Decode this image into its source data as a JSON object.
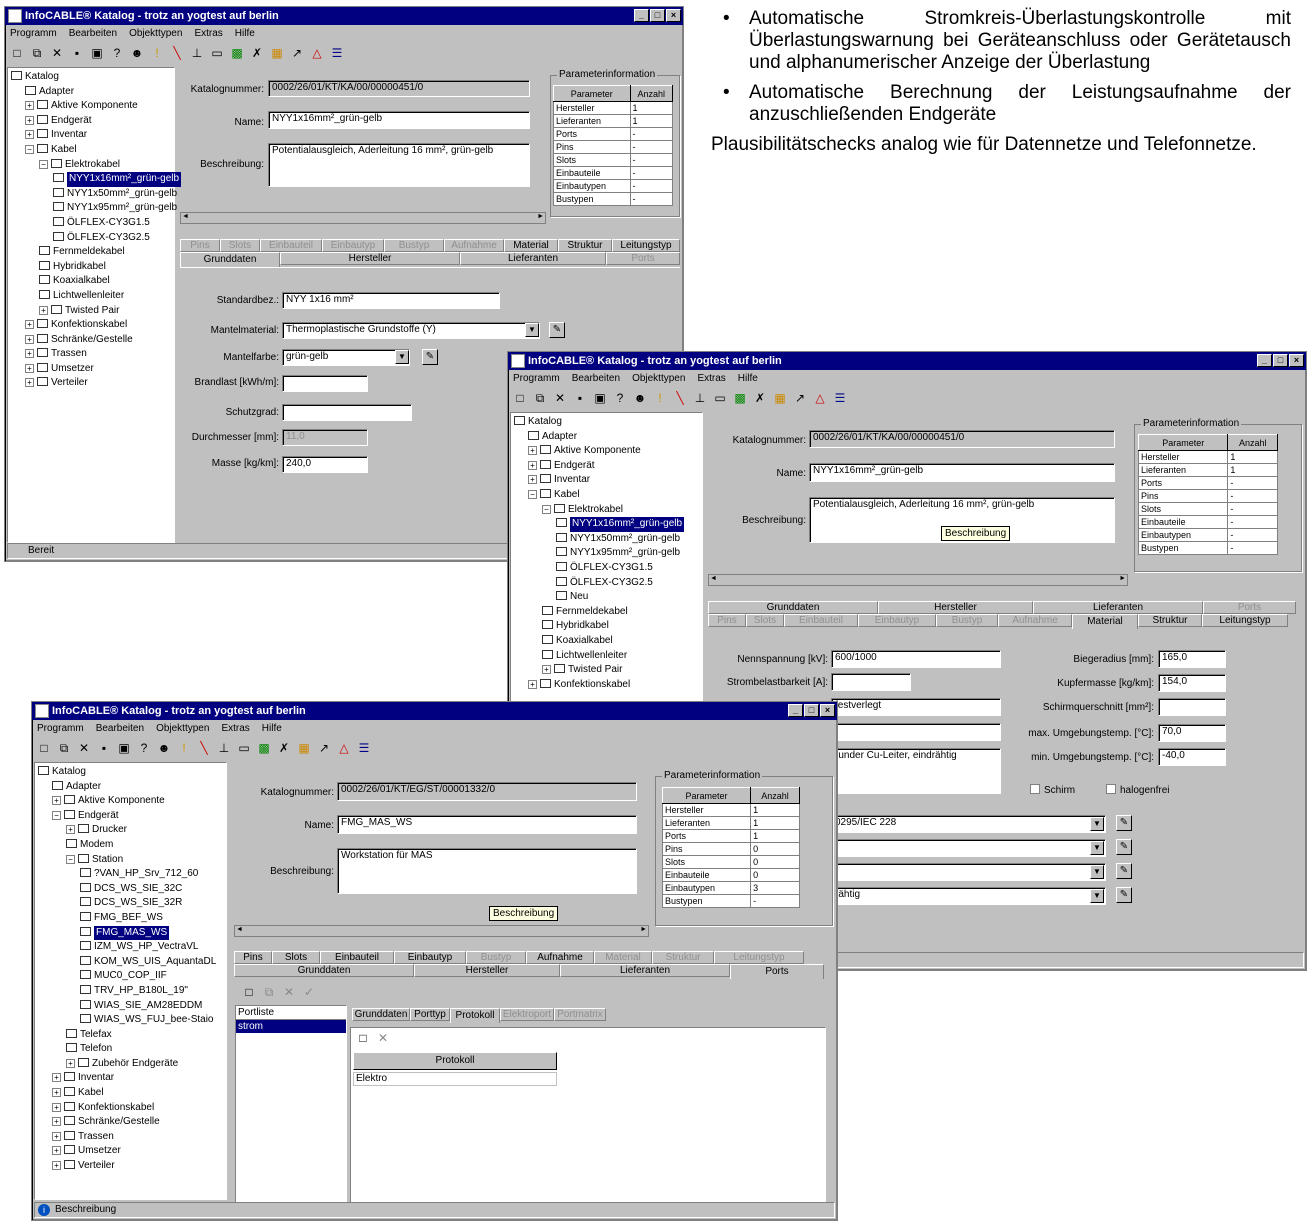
{
  "prose": {
    "bullet1": "Automatische Stromkreis-Überlastungs­kontrolle mit Überlastungswarnung bei Geräteanschluss oder Gerätetausch und alphanumerischer Anzeige der Überlastung",
    "bullet2": "Automatische Berechnung der Leistungsaufnahme der anzuschließenden Endgeräte",
    "paragraph": "Plausibilitätschecks analog wie für Datennetze und Telefonnetze."
  },
  "app": {
    "title": "InfoCABLE® Katalog - trotz an yogtest auf berlin",
    "menu": [
      "Programm",
      "Bearbeiten",
      "Objekttypen",
      "Extras",
      "Hilfe"
    ],
    "window_buttons": [
      "_",
      "□",
      "×"
    ]
  },
  "labels": {
    "katalognummer": "Katalognummer:",
    "name": "Name:",
    "beschreibung": "Beschreibung:",
    "parameterinformation": "Parameterinformation",
    "parameter": "Parameter",
    "anzahl": "Anzahl",
    "standardbez": "Standardbez.:",
    "mantelmaterial": "Mantelmaterial:",
    "mantelfarbe": "Mantelfarbe:",
    "brandlast": "Brandlast [kWh/m]:",
    "schutzgrad": "Schutzgrad:",
    "durchmesser": "Durchmesser [mm]:",
    "masse": "Masse [kg/km]:",
    "nennspannung": "Nennspannung [kV]:",
    "strombelastbarkeit": "Strombelastbarkeit [A]:",
    "biegeradius": "Biegeradius [mm]:",
    "kupfermasse": "Kupfermasse [kg/km]:",
    "schirmquerschnitt": "Schirmquerschnitt [mm²]:",
    "max_temp": "max. Umgebungstemp. [°C]:",
    "min_temp": "min. Umgebungstemp. [°C]:",
    "schirm": "Schirm",
    "halogenfrei": "halogenfrei",
    "portliste": "Portliste",
    "protokoll": "Protokoll"
  },
  "win1": {
    "tree": [
      {
        "t": "Katalog",
        "d": 0
      },
      {
        "t": "Adapter",
        "d": 1
      },
      {
        "t": "Aktive Komponente",
        "d": 1,
        "e": "+"
      },
      {
        "t": "Endgerät",
        "d": 1,
        "e": "+"
      },
      {
        "t": "Inventar",
        "d": 1,
        "e": "+"
      },
      {
        "t": "Kabel",
        "d": 1,
        "e": "-"
      },
      {
        "t": "Elektrokabel",
        "d": 2,
        "e": "-"
      },
      {
        "t": "NYY1x16mm²_grün-gelb",
        "d": 3,
        "sel": true
      },
      {
        "t": "NYY1x50mm²_grün-gelb",
        "d": 3
      },
      {
        "t": "NYY1x95mm²_grün-gelb",
        "d": 3
      },
      {
        "t": "ÖLFLEX-CY3G1.5",
        "d": 3
      },
      {
        "t": "ÖLFLEX-CY3G2.5",
        "d": 3
      },
      {
        "t": "Fernmeldekabel",
        "d": 2
      },
      {
        "t": "Hybridkabel",
        "d": 2
      },
      {
        "t": "Koaxialkabel",
        "d": 2
      },
      {
        "t": "Lichtwellenleiter",
        "d": 2
      },
      {
        "t": "Twisted Pair",
        "d": 2,
        "e": "+"
      },
      {
        "t": "Konfektionskabel",
        "d": 1,
        "e": "+"
      },
      {
        "t": "Schränke/Gestelle",
        "d": 1,
        "e": "+"
      },
      {
        "t": "Trassen",
        "d": 1,
        "e": "+"
      },
      {
        "t": "Umsetzer",
        "d": 1,
        "e": "+"
      },
      {
        "t": "Verteiler",
        "d": 1,
        "e": "+"
      }
    ],
    "katalognummer": "0002/26/01/KT/KA/00/00000451/0",
    "name": "NYY1x16mm²_grün-gelb",
    "beschreibung": "Potentialausgleich, Aderleitung 16 mm²,  grün-gelb",
    "params": [
      [
        "Hersteller",
        "1"
      ],
      [
        "Lieferanten",
        "1"
      ],
      [
        "Ports",
        "-"
      ],
      [
        "Pins",
        "-"
      ],
      [
        "Slots",
        "-"
      ],
      [
        "Einbauteile",
        "-"
      ],
      [
        "Einbautypen",
        "-"
      ],
      [
        "Bustypen",
        "-"
      ]
    ],
    "tabs_back": [
      "Pins",
      "Slots",
      "Einbauteil",
      "Einbautyp",
      "Bustyp",
      "Aufnahme",
      "Material",
      "Struktur",
      "Leitungstyp"
    ],
    "tabs_front": [
      "Grunddaten",
      "Hersteller",
      "Lieferanten",
      "Ports"
    ],
    "standardbez": "NYY 1x16 mm²",
    "mantelmaterial": "Thermoplastische Grundstoffe (Y)",
    "mantelfarbe": "grün-gelb",
    "brandlast": "",
    "schutzgrad": "",
    "durchmesser": "11,0",
    "masse": "240,0",
    "status": "Bereit"
  },
  "win2": {
    "tree": [
      {
        "t": "Katalog",
        "d": 0
      },
      {
        "t": "Adapter",
        "d": 1
      },
      {
        "t": "Aktive Komponente",
        "d": 1,
        "e": "+"
      },
      {
        "t": "Endgerät",
        "d": 1,
        "e": "+"
      },
      {
        "t": "Inventar",
        "d": 1,
        "e": "+"
      },
      {
        "t": "Kabel",
        "d": 1,
        "e": "-"
      },
      {
        "t": "Elektrokabel",
        "d": 2,
        "e": "-"
      },
      {
        "t": "NYY1x16mm²_grün-gelb",
        "d": 3,
        "sel": true
      },
      {
        "t": "NYY1x50mm²_grün-gelb",
        "d": 3
      },
      {
        "t": "NYY1x95mm²_grün-gelb",
        "d": 3
      },
      {
        "t": "ÖLFLEX-CY3G1.5",
        "d": 3
      },
      {
        "t": "ÖLFLEX-CY3G2.5",
        "d": 3
      },
      {
        "t": "Neu",
        "d": 3
      },
      {
        "t": "Fernmeldekabel",
        "d": 2
      },
      {
        "t": "Hybridkabel",
        "d": 2
      },
      {
        "t": "Koaxialkabel",
        "d": 2
      },
      {
        "t": "Lichtwellenleiter",
        "d": 2
      },
      {
        "t": "Twisted Pair",
        "d": 2,
        "e": "+"
      },
      {
        "t": "Konfektionskabel",
        "d": 1,
        "e": "+"
      }
    ],
    "katalognummer": "0002/26/01/KT/KA/00/00000451/0",
    "name": "NYY1x16mm²_grün-gelb",
    "beschreibung": "Potentialausgleich, Aderleitung 16 mm²,  grün-gelb",
    "tooltip": "Beschreibung",
    "params": [
      [
        "Hersteller",
        "1"
      ],
      [
        "Lieferanten",
        "1"
      ],
      [
        "Ports",
        "-"
      ],
      [
        "Pins",
        "-"
      ],
      [
        "Slots",
        "-"
      ],
      [
        "Einbauteile",
        "-"
      ],
      [
        "Einbautypen",
        "-"
      ],
      [
        "Bustypen",
        "-"
      ]
    ],
    "tabs_back": [
      "Grunddaten",
      "Hersteller",
      "Lieferanten",
      "Ports"
    ],
    "tabs_front": [
      "Pins",
      "Slots",
      "Einbauteil",
      "Einbautyp",
      "Bustyp",
      "Aufnahme",
      "Material",
      "Struktur",
      "Leitungstyp"
    ],
    "nennspannung": "600/1000",
    "strombelastbarkeit": "",
    "verlegung": "festverlegt",
    "field4": "",
    "leiter": "runder Cu-Leiter, eindrähtig",
    "biegeradius": "165,0",
    "kupfermasse": "154,0",
    "schirmquerschnitt": "",
    "max_temp": "70,0",
    "min_temp": "-40,0",
    "norm": "0295/IEC 228",
    "drop2": "",
    "drop3": "",
    "drop4": "rähtig"
  },
  "win3": {
    "tree": [
      {
        "t": "Katalog",
        "d": 0
      },
      {
        "t": "Adapter",
        "d": 1
      },
      {
        "t": "Aktive Komponente",
        "d": 1,
        "e": "+"
      },
      {
        "t": "Endgerät",
        "d": 1,
        "e": "-"
      },
      {
        "t": "Drucker",
        "d": 2,
        "e": "+"
      },
      {
        "t": "Modem",
        "d": 2
      },
      {
        "t": "Station",
        "d": 2,
        "e": "-"
      },
      {
        "t": "?VAN_HP_Srv_712_60",
        "d": 3
      },
      {
        "t": "DCS_WS_SIE_32C",
        "d": 3
      },
      {
        "t": "DCS_WS_SIE_32R",
        "d": 3
      },
      {
        "t": "FMG_BEF_WS",
        "d": 3
      },
      {
        "t": "FMG_MAS_WS",
        "d": 3,
        "sel": true
      },
      {
        "t": "IZM_WS_HP_VectraVL",
        "d": 3
      },
      {
        "t": "KOM_WS_UIS_AquantaDL",
        "d": 3
      },
      {
        "t": "MUC0_COP_IIF",
        "d": 3
      },
      {
        "t": "TRV_HP_B180L_19\"",
        "d": 3
      },
      {
        "t": "WIAS_SIE_AM28EDDM",
        "d": 3
      },
      {
        "t": "WIAS_WS_FUJ_bee-Staio",
        "d": 3
      },
      {
        "t": "Telefax",
        "d": 2
      },
      {
        "t": "Telefon",
        "d": 2
      },
      {
        "t": "Zubehör Endgeräte",
        "d": 2,
        "e": "+"
      },
      {
        "t": "Inventar",
        "d": 1,
        "e": "+"
      },
      {
        "t": "Kabel",
        "d": 1,
        "e": "+"
      },
      {
        "t": "Konfektionskabel",
        "d": 1,
        "e": "+"
      },
      {
        "t": "Schränke/Gestelle",
        "d": 1,
        "e": "+"
      },
      {
        "t": "Trassen",
        "d": 1,
        "e": "+"
      },
      {
        "t": "Umsetzer",
        "d": 1,
        "e": "+"
      },
      {
        "t": "Verteiler",
        "d": 1,
        "e": "+"
      }
    ],
    "katalognummer": "0002/26/01/KT/EG/ST/00001332/0",
    "name": "FMG_MAS_WS",
    "beschreibung": "Workstation für MAS",
    "tooltip": "Beschreibung",
    "params": [
      [
        "Hersteller",
        "1"
      ],
      [
        "Lieferanten",
        "1"
      ],
      [
        "Ports",
        "1"
      ],
      [
        "Pins",
        "0"
      ],
      [
        "Slots",
        "0"
      ],
      [
        "Einbauteile",
        "0"
      ],
      [
        "Einbautypen",
        "3"
      ],
      [
        "Bustypen",
        "-"
      ]
    ],
    "tabs_back": [
      "Pins",
      "Slots",
      "Einbauteil",
      "Einbautyp",
      "Bustyp",
      "Aufnahme",
      "Material",
      "Struktur",
      "Leitungstyp"
    ],
    "tabs_front": [
      "Grunddaten",
      "Hersteller",
      "Lieferanten",
      "Ports"
    ],
    "ports": [
      "strom"
    ],
    "subtabs": [
      "Grunddaten",
      "Porttyp",
      "Protokoll",
      "Elektroport",
      "Portmatrix"
    ],
    "protokoll_rows": [
      "Elektro"
    ],
    "status": "Beschreibung"
  }
}
